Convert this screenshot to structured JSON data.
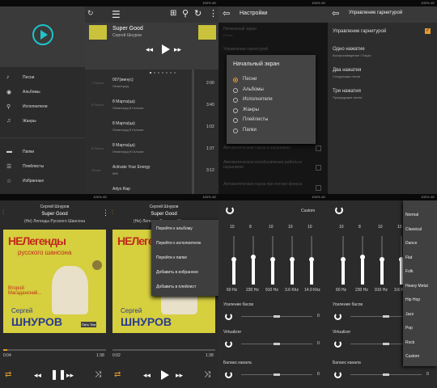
{
  "status_bar": {
    "text": "100% 4G"
  },
  "drawer": {
    "items": [
      {
        "icon": "music-note-icon",
        "label": "Песни"
      },
      {
        "icon": "album-icon",
        "label": "Альбомы"
      },
      {
        "icon": "microphone-icon",
        "label": "Исполнители"
      },
      {
        "icon": "guitar-icon",
        "label": "Жанры"
      },
      {
        "icon": "folder-icon",
        "label": "Папки"
      },
      {
        "icon": "playlist-icon",
        "label": "Плейлисты"
      },
      {
        "icon": "star-icon",
        "label": "Избранные"
      }
    ]
  },
  "library": {
    "now_playing_title": "Super Good",
    "now_playing_artist": "Сергей Шнуров",
    "dots_count": 7,
    "tracks": [
      {
        "num": "7 Песня",
        "title": "007(минус)",
        "artist": "Ленинград",
        "duration": "2:00"
      },
      {
        "num": "8 Песня",
        "title": "8 Марта(ца)",
        "artist": "Ленинград ft.Гальган",
        "duration": "3:40"
      },
      {
        "num": "",
        "title": "8 Марта(ца)",
        "artist": "Ленинград ft.Гальган",
        "duration": "1:02"
      },
      {
        "num": "8 Песня",
        "title": "8 Марта(ца)",
        "artist": "Ленинград ft.Гальган",
        "duration": "1:37"
      },
      {
        "num": "Песня",
        "title": "Activate Your Energy",
        "artist": "666",
        "duration": "3:12"
      },
      {
        "num": "",
        "title": "Adyo Rap",
        "artist": "",
        "duration": ""
      }
    ]
  },
  "settings": {
    "title": "Настройки",
    "bg_items": [
      {
        "title": "Начальный экран",
        "sub": "Песни"
      },
      {
        "title": "Управление гарнитурой",
        "sub": ""
      },
      {
        "title": "",
        "sub": ""
      },
      {
        "title": "",
        "sub": ""
      },
      {
        "title": "Автоматическая пауза в наушниках",
        "sub": ""
      },
      {
        "title": "Автоматическое возобновление работы в наушниках",
        "sub": ""
      },
      {
        "title": "Автоматическая пауза при потере фокуса",
        "sub": ""
      }
    ],
    "dialog": {
      "title": "Начальный экран",
      "options": [
        "Песни",
        "Альбомы",
        "Исполнители",
        "Жанры",
        "Плейлисты",
        "Папки"
      ],
      "selected": 0
    }
  },
  "headset": {
    "title": "Управление гарнитурой",
    "toggle_label": "Управление гарнитурой",
    "toggle_checked": true,
    "items": [
      {
        "title": "Одно нажатие",
        "sub": "Воспроизведение / Пауза"
      },
      {
        "title": "Два нажатия",
        "sub": "Следующая песня"
      },
      {
        "title": "Три нажатия",
        "sub": "Предыдущая песня"
      }
    ]
  },
  "player": {
    "artist": "Сергей Шнуров",
    "title": "Super Good",
    "album": "(Не) Легенды Русского Шансона",
    "elapsed": "0:04",
    "elapsed2": "0:02",
    "total": "1:38",
    "progress": 0.04,
    "cover": {
      "line1": "НЕЛегенды",
      "line2": "русского шансона",
      "line3": "Второй Магаданский...",
      "artist1": "Сергей",
      "artist2": "ШНУРОВ",
      "extra": "Пять Тем"
    }
  },
  "context_menu": [
    "Перейти к альбому",
    "Перейти к исполнителю",
    "Перейти к папке",
    "Добавить в избранное",
    "Добавить в плейлист"
  ],
  "equalizer": {
    "preset": "Custom",
    "bands": [
      {
        "label": "60 Hz",
        "value": "10",
        "level": 0.5
      },
      {
        "label": "230 Hz",
        "value": "8",
        "level": 0.55
      },
      {
        "label": "910 Hz",
        "value": "10",
        "level": 0.5
      },
      {
        "label": "3.6 Khz",
        "value": "10",
        "level": 0.5
      },
      {
        "label": "14.0 Khz",
        "value": "10",
        "level": 0.5
      }
    ],
    "bass_label": "Усиление басов",
    "virt_label": "Virtualizer",
    "balance_label": "Баланс канала",
    "bass_value": "0",
    "virt_value": "0",
    "balance_value": "0",
    "presets": [
      "Normal",
      "Classical",
      "Dance",
      "Flat",
      "Folk",
      "Heavy Metal",
      "Hip Hop",
      "Jazz",
      "Pop",
      "Rock",
      "Custom"
    ]
  }
}
